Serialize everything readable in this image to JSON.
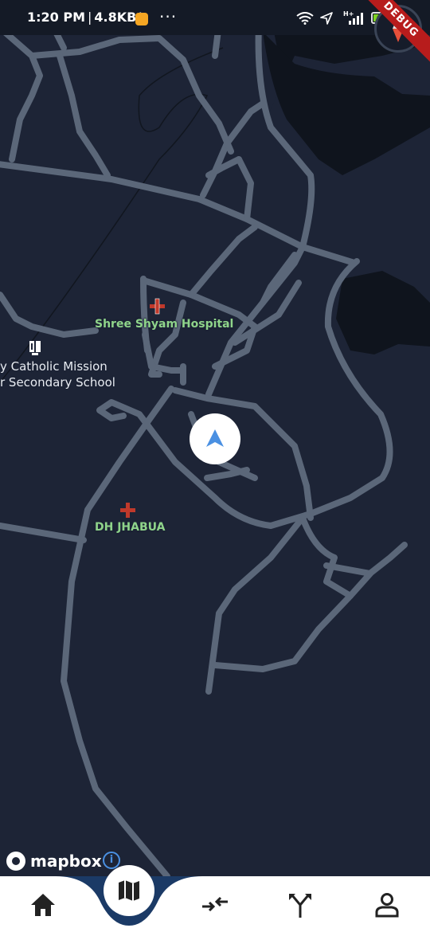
{
  "status_bar": {
    "time": "1:20 PM",
    "net_speed": "4.8KB/s",
    "more": "···",
    "network_type": "H+",
    "battery_level": "40",
    "battery_fraction": 0.4,
    "icons": [
      "app-notification-icon",
      "wifi-icon",
      "location-arrow-icon",
      "signal-icon",
      "battery-icon"
    ]
  },
  "debug_banner": {
    "label": "DEBUG"
  },
  "map": {
    "pois": [
      {
        "label": "Shree Shyam Hospital",
        "icon": "hospital-cross-icon"
      },
      {
        "label": "DH JHABUA",
        "icon": "hospital-cross-icon"
      }
    ],
    "school": {
      "line1": "y Catholic Mission",
      "line2": "r Secondary School",
      "icon": "school-icon"
    },
    "colors": {
      "background": "#1d2436",
      "roads": "#5b6779",
      "water": "#0f141d",
      "poi_text": "#8fd48a",
      "hospital_icon": "#c0392b",
      "location_arrow": "#4a90e2"
    }
  },
  "attribution": {
    "logo_text": "mapbox",
    "info": "i"
  },
  "bottom_nav": {
    "active_color": "#1b3a66",
    "items": [
      {
        "id": "home",
        "icon": "home-icon"
      },
      {
        "id": "map",
        "icon": "map-icon",
        "active": true
      },
      {
        "id": "merge",
        "icon": "merge-arrows-icon"
      },
      {
        "id": "split",
        "icon": "split-route-icon"
      },
      {
        "id": "profile",
        "icon": "person-icon"
      }
    ]
  }
}
